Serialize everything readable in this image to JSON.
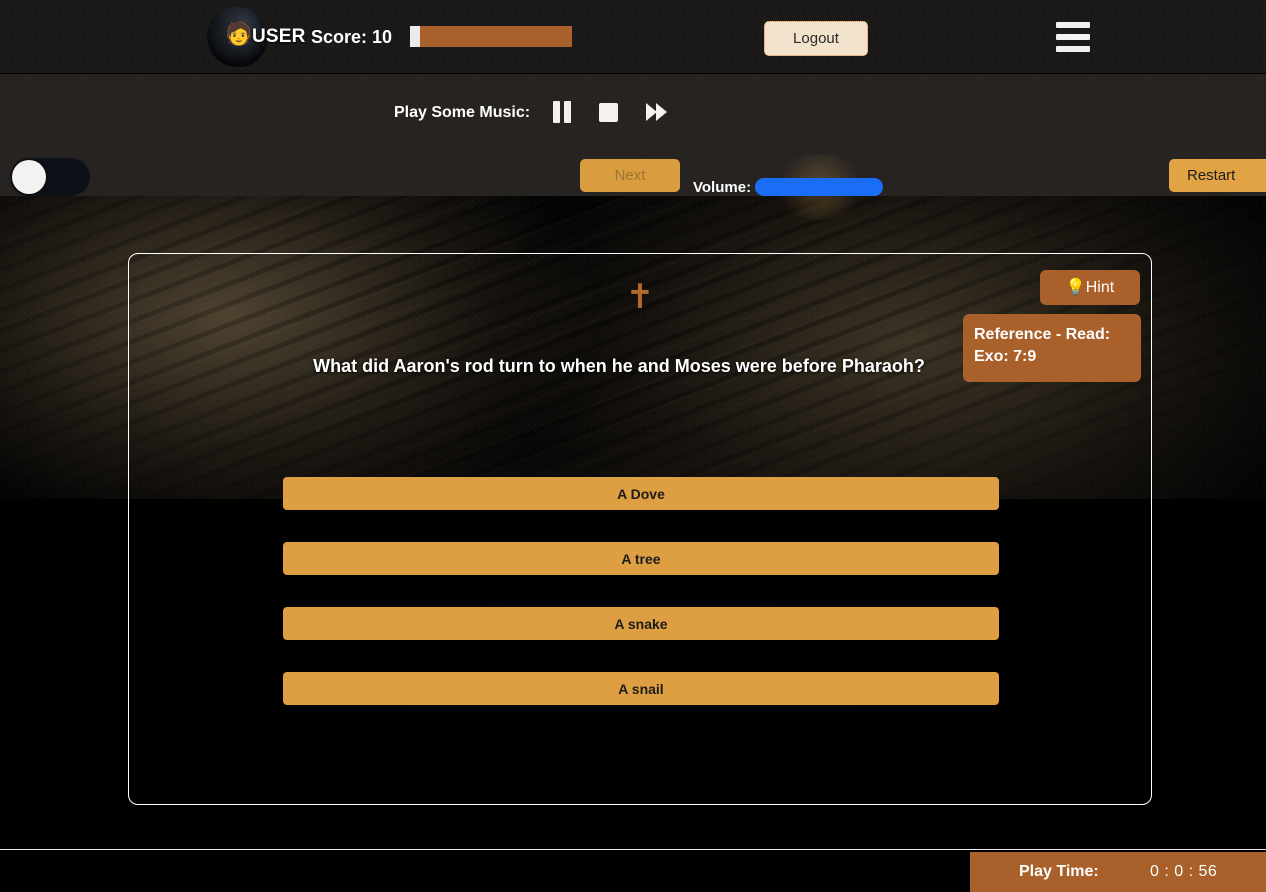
{
  "header": {
    "avatar_icon": "user-avatar-emoji",
    "avatar_glyph": "🧑",
    "username": "USER",
    "score_label": "Score: 10",
    "score_value": 10,
    "score_fill_percent": 94,
    "logout_label": "Logout",
    "menu_icon": "hamburger-menu-icon"
  },
  "music_bar": {
    "label": "Play Some Music:",
    "pause_icon": "pause-icon",
    "stop_icon": "stop-icon",
    "forward_icon": "fast-forward-icon",
    "volume_label": "Volume:",
    "volume_percent": 100,
    "volume_color": "#1a6ef5"
  },
  "toolbar": {
    "theme_toggle_state": "off",
    "next_label": "Next",
    "next_disabled": true,
    "restart_label": "Restart"
  },
  "quiz": {
    "cross_icon": "cross-icon",
    "cross_glyph": "✝",
    "question": "What did Aaron's rod turn to when he and Moses were before Pharaoh?",
    "hint_label": "Hint",
    "hint_icon": "lightbulb-icon",
    "hint_glyph": "💡",
    "reference_text": "Reference - Read: Exo: 7:9",
    "answers": [
      {
        "label": "A Dove"
      },
      {
        "label": "A tree"
      },
      {
        "label": "A snake"
      },
      {
        "label": "A snail"
      }
    ]
  },
  "footer": {
    "playtime_label": "Play Time:",
    "playtime_value": "0 : 0 : 56"
  },
  "colors": {
    "accent_orange": "#dd9f42",
    "brand_brown": "#a9602a",
    "header_bg": "#1b1917",
    "bar_bg": "#262321",
    "volume_blue": "#1a6ef5",
    "card_border": "#ffffff"
  }
}
